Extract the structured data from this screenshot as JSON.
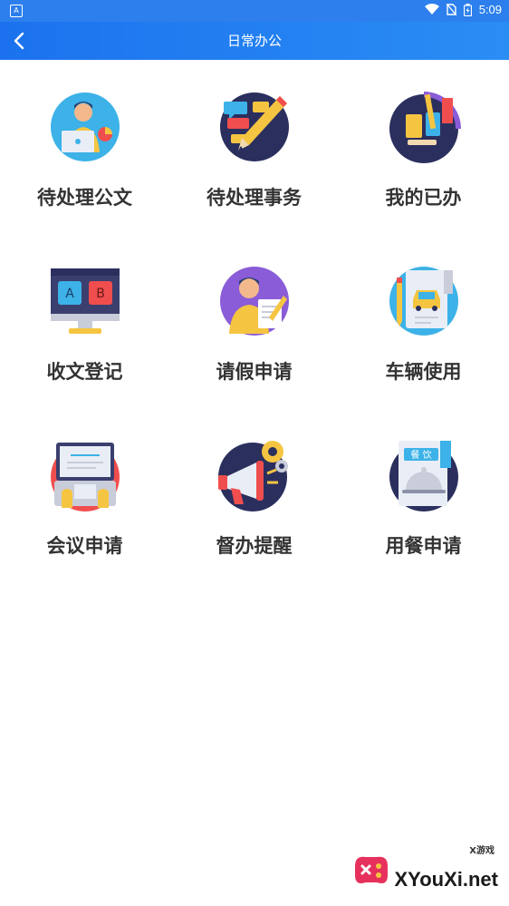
{
  "status_bar": {
    "time": "5:09",
    "left_glyph": "A"
  },
  "header": {
    "title": "日常办公"
  },
  "tiles": [
    {
      "label": "待处理公文"
    },
    {
      "label": "待处理事务"
    },
    {
      "label": "我的已办"
    },
    {
      "label": "收文登记"
    },
    {
      "label": "请假申请"
    },
    {
      "label": "车辆使用"
    },
    {
      "label": "会议申请"
    },
    {
      "label": "督办提醒"
    },
    {
      "label": "用餐申请"
    }
  ],
  "icon_text": {
    "ab_a": "A",
    "ab_b": "B",
    "meal_sign": "餐 饮"
  },
  "watermark": {
    "brand": "XYouXi.net",
    "small": "X游戏"
  },
  "colors": {
    "header_start": "#1c72ee",
    "header_end": "#2a8df4",
    "label": "#333333"
  }
}
